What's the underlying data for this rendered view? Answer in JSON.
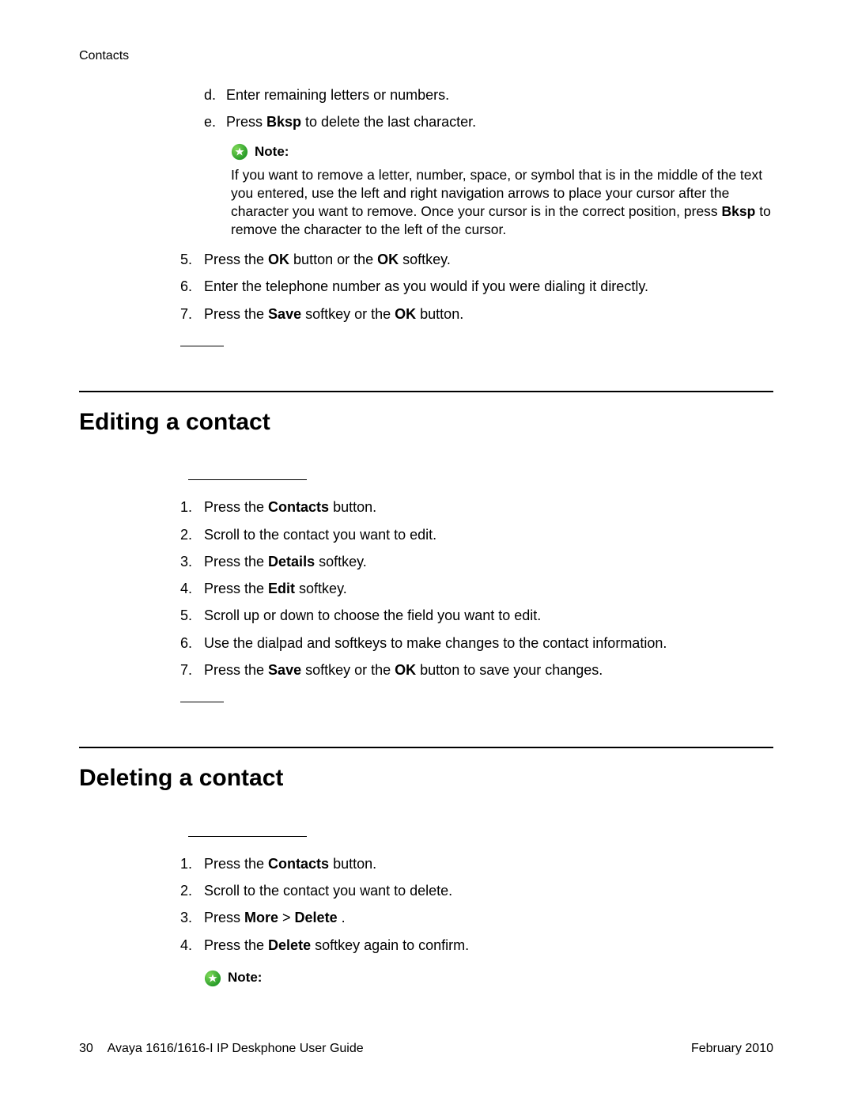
{
  "header": {
    "chapter": "Contacts"
  },
  "topSubList": [
    {
      "marker": "d.",
      "text_pre": "Enter remaining letters or numbers.",
      "bold1": "",
      "text_mid": "",
      "bold2": "",
      "text_post": ""
    },
    {
      "marker": "e.",
      "text_pre": "Press ",
      "bold1": "Bksp",
      "text_mid": " to delete the last character.",
      "bold2": "",
      "text_post": ""
    }
  ],
  "note1": {
    "label": "Note:",
    "body_pre": "If you want to remove a letter, number, space, or symbol that is in the middle of the text you entered, use the left and right navigation arrows to place your cursor after the character you want to remove. Once your cursor is in the correct position, press ",
    "body_bold": "Bksp",
    "body_post": " to remove the character to the left of the cursor."
  },
  "numList1": [
    {
      "marker": "5.",
      "p1": "Press the ",
      "b1": "OK",
      "p2": " button or the ",
      "b2": "OK",
      "p3": " softkey.",
      "b3": "",
      "p4": ""
    },
    {
      "marker": "6.",
      "p1": "Enter the telephone number as you would if you were dialing it directly.",
      "b1": "",
      "p2": "",
      "b2": "",
      "p3": "",
      "b3": "",
      "p4": ""
    },
    {
      "marker": "7.",
      "p1": "Press the ",
      "b1": "Save",
      "p2": " softkey or the ",
      "b2": "OK",
      "p3": " button.",
      "b3": "",
      "p4": ""
    }
  ],
  "section2": {
    "heading": "Editing a contact",
    "steps": [
      {
        "marker": "1.",
        "p1": "Press the ",
        "b1": "Contacts",
        "p2": " button.",
        "b2": "",
        "p3": "",
        "b3": "",
        "p4": ""
      },
      {
        "marker": "2.",
        "p1": "Scroll to the contact you want to edit.",
        "b1": "",
        "p2": "",
        "b2": "",
        "p3": "",
        "b3": "",
        "p4": ""
      },
      {
        "marker": "3.",
        "p1": "Press the ",
        "b1": "Details",
        "p2": " softkey.",
        "b2": "",
        "p3": "",
        "b3": "",
        "p4": ""
      },
      {
        "marker": "4.",
        "p1": "Press the ",
        "b1": "Edit",
        "p2": " softkey.",
        "b2": "",
        "p3": "",
        "b3": "",
        "p4": ""
      },
      {
        "marker": "5.",
        "p1": "Scroll up or down to choose the field you want to edit.",
        "b1": "",
        "p2": "",
        "b2": "",
        "p3": "",
        "b3": "",
        "p4": ""
      },
      {
        "marker": "6.",
        "p1": "Use the dialpad and softkeys to make changes to the contact information.",
        "b1": "",
        "p2": "",
        "b2": "",
        "p3": "",
        "b3": "",
        "p4": ""
      },
      {
        "marker": "7.",
        "p1": "Press the ",
        "b1": "Save",
        "p2": " softkey or the ",
        "b2": "OK",
        "p3": " button to save your changes.",
        "b3": "",
        "p4": ""
      }
    ]
  },
  "section3": {
    "heading": "Deleting a contact",
    "steps": [
      {
        "marker": "1.",
        "p1": "Press the ",
        "b1": "Contacts",
        "p2": " button.",
        "b2": "",
        "p3": "",
        "b3": "",
        "p4": ""
      },
      {
        "marker": "2.",
        "p1": "Scroll to the contact you want to delete.",
        "b1": "",
        "p2": "",
        "b2": "",
        "p3": "",
        "b3": "",
        "p4": ""
      },
      {
        "marker": "3.",
        "p1": "Press ",
        "b1": "More",
        "p2": " > ",
        "b2": "Delete",
        "p3": " .",
        "b3": "",
        "p4": ""
      },
      {
        "marker": "4.",
        "p1": "Press the ",
        "b1": "Delete",
        "p2": " softkey again to confirm.",
        "b2": "",
        "p3": "",
        "b3": "",
        "p4": ""
      }
    ]
  },
  "note2": {
    "label": "Note:"
  },
  "footer": {
    "page": "30",
    "title": "Avaya 1616/1616-I IP Deskphone User Guide",
    "date": "February 2010"
  }
}
